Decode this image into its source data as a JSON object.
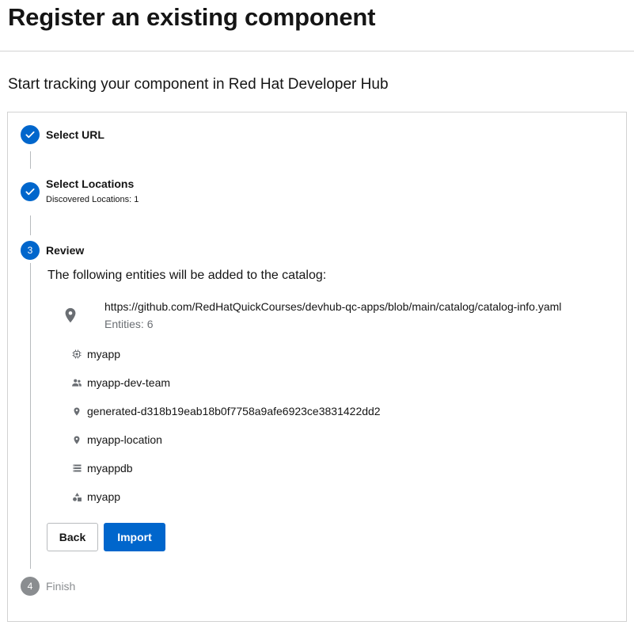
{
  "header": {
    "title": "Register an existing component",
    "subtitle": "Start tracking your component in Red Hat Developer Hub"
  },
  "stepper": {
    "steps": [
      {
        "label": "Select URL",
        "state": "completed",
        "icon": "check-icon"
      },
      {
        "label": "Select Locations",
        "sub": "Discovered Locations: 1",
        "state": "completed",
        "icon": "check-icon"
      },
      {
        "number": "3",
        "label": "Review",
        "state": "active"
      },
      {
        "number": "4",
        "label": "Finish",
        "state": "pending"
      }
    ]
  },
  "review": {
    "intro": "The following entities will be added to the catalog:",
    "location": {
      "url": "https://github.com/RedHatQuickCourses/devhub-qc-apps/blob/main/catalog/catalog-info.yaml",
      "entities_count": "Entities: 6",
      "icon": "location-pin-icon"
    },
    "entities": [
      {
        "name": "myapp",
        "icon": "component-icon"
      },
      {
        "name": "myapp-dev-team",
        "icon": "group-icon"
      },
      {
        "name": "generated-d318b19eab18b0f7758a9afe6923ce3831422dd2",
        "icon": "location-pin-icon"
      },
      {
        "name": "myapp-location",
        "icon": "location-pin-icon"
      },
      {
        "name": "myappdb",
        "icon": "resource-icon"
      },
      {
        "name": "myapp",
        "icon": "system-icon"
      }
    ]
  },
  "actions": {
    "back_label": "Back",
    "import_label": "Import"
  },
  "colors": {
    "primary": "#0066cc",
    "pending": "#8a8d90",
    "border": "#d2d2d2",
    "muted_text": "#6a6e73"
  }
}
